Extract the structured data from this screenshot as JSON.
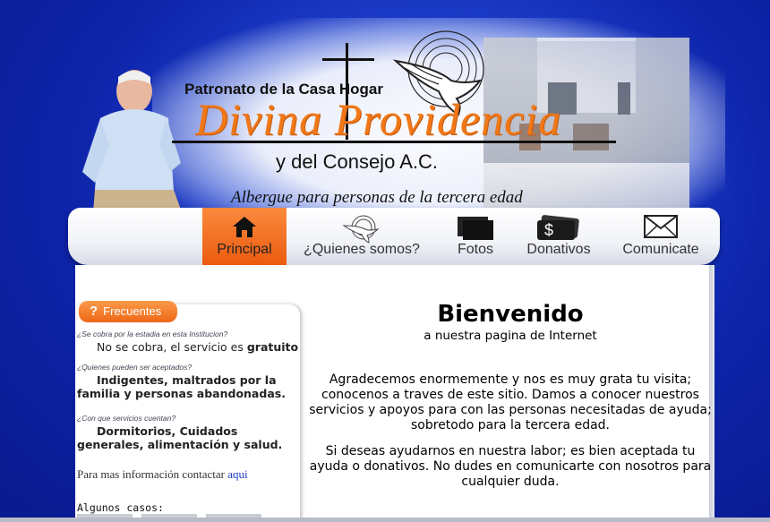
{
  "header": {
    "patronato": "Patronato de la Casa Hogar",
    "name": "Divina Providencia",
    "consejo": "y del Consejo A.C.",
    "tagline": "Albergue para personas de la tercera edad"
  },
  "nav": {
    "items": [
      {
        "label": "Principal",
        "icon": "home-icon",
        "active": true
      },
      {
        "label": "¿Quienes somos?",
        "icon": "dove-logo-icon",
        "active": false
      },
      {
        "label": "Fotos",
        "icon": "photos-icon",
        "active": false
      },
      {
        "label": "Donativos",
        "icon": "money-icon",
        "active": false
      },
      {
        "label": "Comunicate",
        "icon": "envelope-icon",
        "active": false
      }
    ]
  },
  "faq": {
    "tab_label": "Frecuentes",
    "items": [
      {
        "q": "¿Se cobra por la estadia en esta Institucion?",
        "a_prefix": "No se cobra, el servicio es ",
        "a_bold": "gratuito"
      },
      {
        "q": "¿Quienes pueden ser aceptados?",
        "a_bold": "Indigentes, maltrados por la familia y personas abandonadas."
      },
      {
        "q": "¿Con que servicios cuentan?",
        "a_bold": "Dormitorios, Cuidados generales, alimentación y salud."
      }
    ],
    "contact_text": "Para mas información contactar ",
    "contact_link": "aqui",
    "casos": "Algunos casos:"
  },
  "main": {
    "title": "Bienvenido",
    "subtitle": "a nuestra  pagina de Internet",
    "para1": "Agradecemos enormemente y nos es muy grata tu visita; conocenos a traves de este sitio. Damos a conocer nuestros servicios y apoyos para con las personas necesitadas de ayuda; sobretodo para la tercera edad.",
    "para2": "Si deseas ayudarnos en nuestra labor; es bien aceptada tu ayuda o donativos. No dudes en comunicarte con nosotros para cualquier duda."
  },
  "colors": {
    "background": "#0d23a8",
    "accent": "#f07818",
    "nav_active": "#ec5b10"
  }
}
